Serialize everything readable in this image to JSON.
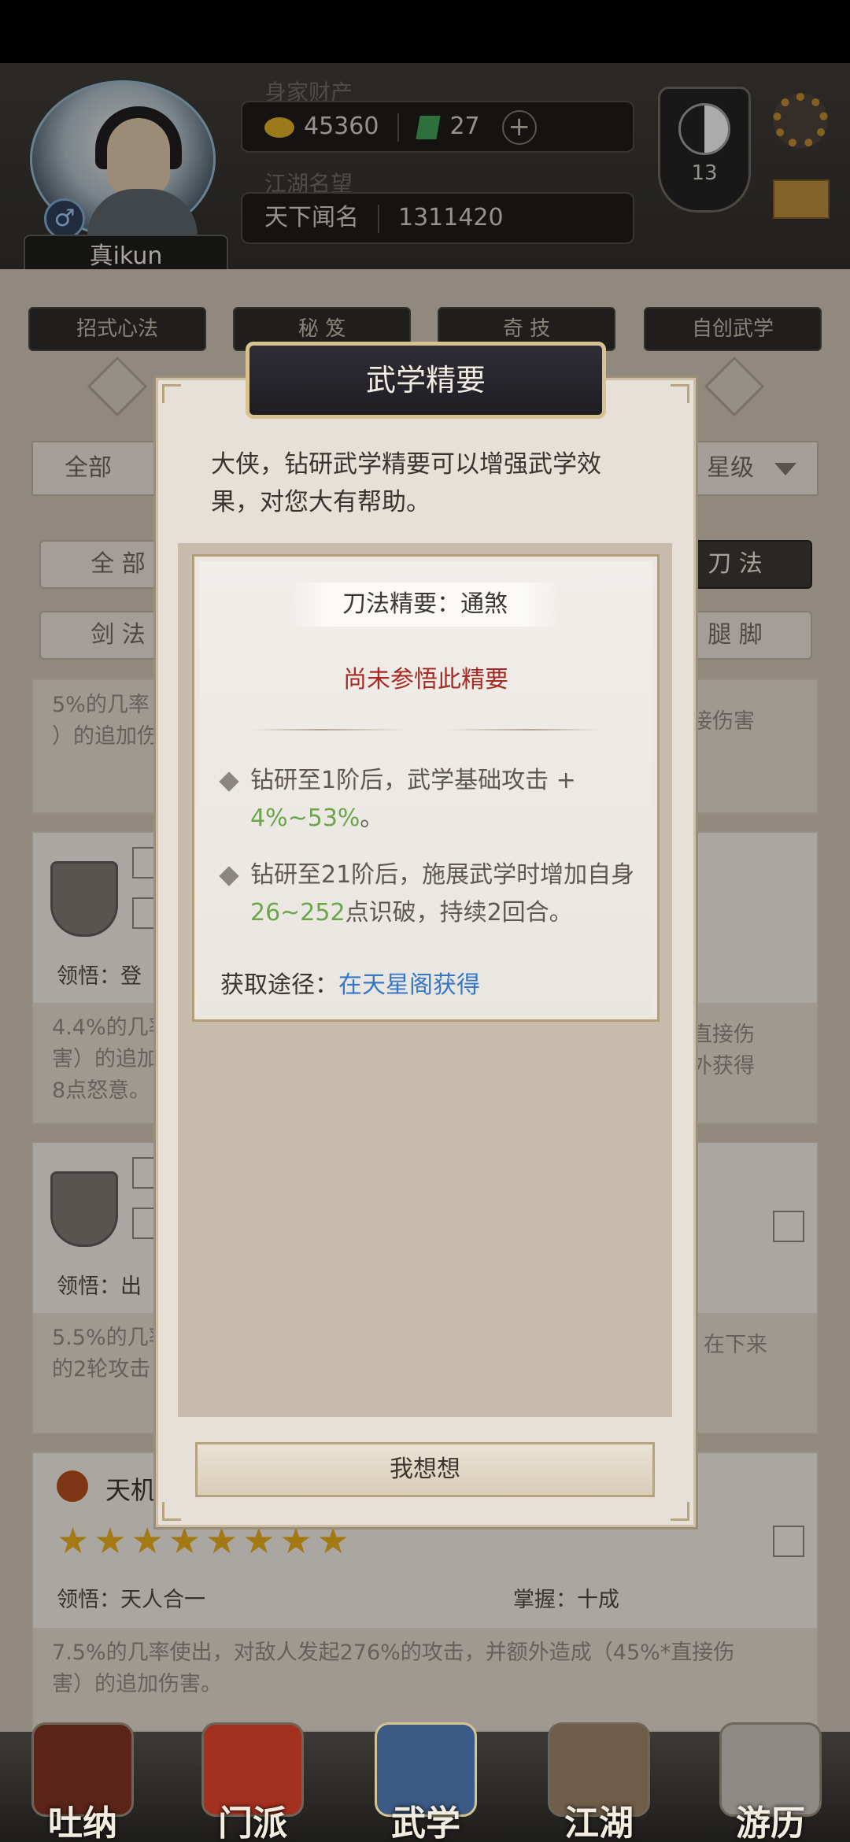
{
  "header": {
    "wealth_label": "身家财产",
    "gold": "45360",
    "jade": "27",
    "reputation_label": "江湖名望",
    "reputation_title": "天下闻名",
    "reputation_value": "1311420",
    "player_name": "真ikun",
    "gender_symbol": "♂",
    "level": "13"
  },
  "tabs": [
    "招式心法",
    "秘 笈",
    "奇 技",
    "自创武学"
  ],
  "filters": {
    "left": "全部",
    "right": "星级"
  },
  "chips": {
    "row1": [
      "全 部",
      "刀 法"
    ],
    "row2": [
      "剑 法",
      "腿 脚"
    ]
  },
  "background_cards": [
    {
      "desc_left": "5%的几率",
      "desc_left2": "）的追加伤",
      "desc_right": "接伤害"
    },
    {
      "insight": "领悟：登",
      "desc_left": "4.4%的几率",
      "desc_left2": "害）的追加",
      "desc_left3": "8点怒意。",
      "desc_right": "直接伤",
      "desc_right2": "外获得"
    },
    {
      "insight": "领悟：出",
      "desc_left": "5.5%的几率",
      "desc_left2": "的2轮攻击",
      "desc_right": "在下来"
    },
    {
      "name": "天机",
      "insight": "领悟：天人合一",
      "mastery": "掌握：十成",
      "desc": "7.5%的几率使出，对敌人发起276%的攻击，并额外造成（45%*直接伤",
      "desc2": "害）的追加伤害。"
    }
  ],
  "modal": {
    "title": "武学精要",
    "intro": "大侠，钻研武学精要可以增强武学效果，对您大有帮助。",
    "card_title": "刀法精要：通煞",
    "status": "尚未参悟此精要",
    "effect1_prefix": "钻研至1阶后，武学基础攻击 + ",
    "effect1_value": "4%~53%",
    "effect1_suffix": "。",
    "effect2_prefix": "钻研至21阶后，施展武学时增加自身",
    "effect2_value": "26~252",
    "effect2_suffix": "点识破，持续2回合。",
    "acquire_label": "获取途径：",
    "acquire_link": "在天星阁获得",
    "button": "我想想"
  },
  "bottom_nav": [
    "吐纳",
    "门派",
    "武学",
    "江湖",
    "游历"
  ],
  "colors": {
    "accent_gold": "#d7c38f",
    "status_red": "#a82a22",
    "value_green": "#6ba64a",
    "link_blue": "#3677c6"
  }
}
